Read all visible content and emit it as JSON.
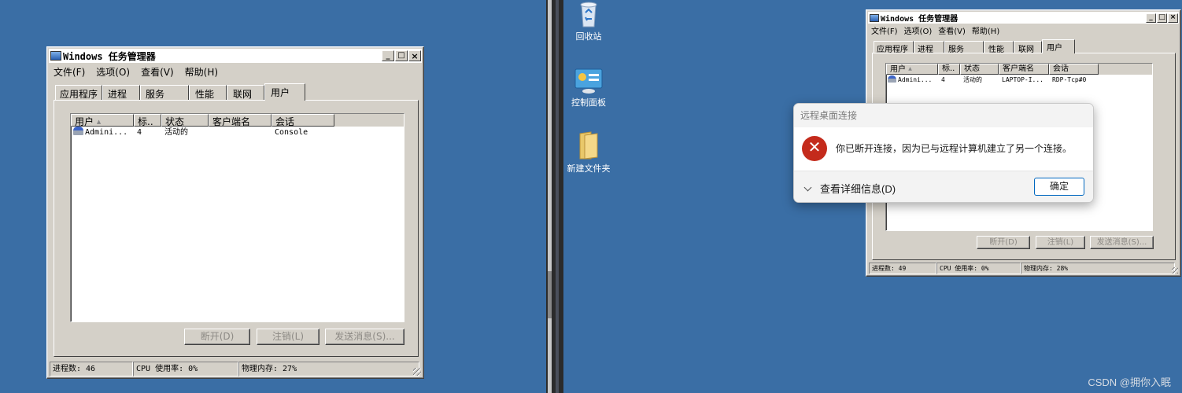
{
  "colors": {
    "desktop": "#3a6ea5",
    "error": "#c42b1c",
    "accent_button": "#0067c0"
  },
  "left_task_manager": {
    "title": "Windows 任务管理器",
    "menu": [
      "文件(F)",
      "选项(O)",
      "查看(V)",
      "帮助(H)"
    ],
    "tabs": [
      "应用程序",
      "进程",
      "服务",
      "性能",
      "联网",
      "用户"
    ],
    "active_tab": "用户",
    "columns": [
      "用户",
      "标..",
      "状态",
      "客户端名",
      "会话"
    ],
    "sort_indicator": "▲",
    "rows": [
      {
        "user": "Admini...",
        "id": "4",
        "status": "活动的",
        "client": "",
        "session": "Console"
      }
    ],
    "buttons": [
      "断开(D)",
      "注销(L)",
      "发送消息(S)..."
    ],
    "status": [
      "进程数: 46",
      "CPU 使用率: 0%",
      "物理内存: 27%"
    ]
  },
  "desktop_icons": [
    {
      "label": "回收站",
      "icon": "recycle-bin-icon"
    },
    {
      "label": "控制面板",
      "icon": "control-panel-icon"
    },
    {
      "label": "新建文件夹",
      "icon": "folder-icon"
    }
  ],
  "right_task_manager": {
    "title": "Windows 任务管理器",
    "menu": [
      "文件(F)",
      "选项(O)",
      "查看(V)",
      "帮助(H)"
    ],
    "tabs": [
      "应用程序",
      "进程",
      "服务",
      "性能",
      "联网",
      "用户"
    ],
    "active_tab": "用户",
    "columns": [
      "用户",
      "标..",
      "状态",
      "客户端名",
      "会话"
    ],
    "sort_indicator": "▲",
    "rows": [
      {
        "user": "Admini...",
        "id": "4",
        "status": "活动的",
        "client": "LAPTOP-I...",
        "session": "RDP-Tcp#0"
      }
    ],
    "buttons": [
      "断开(D)",
      "注销(L)",
      "发送消息(S)..."
    ],
    "status": [
      "进程数: 49",
      "CPU 使用率: 0%",
      "物理内存: 28%"
    ]
  },
  "dialog": {
    "title": "远程桌面连接",
    "message": "你已断开连接，因为已与远程计算机建立了另一个连接。",
    "details_label": "查看详细信息(D)",
    "ok_label": "确定"
  },
  "watermark": "CSDN @拥你入眠"
}
